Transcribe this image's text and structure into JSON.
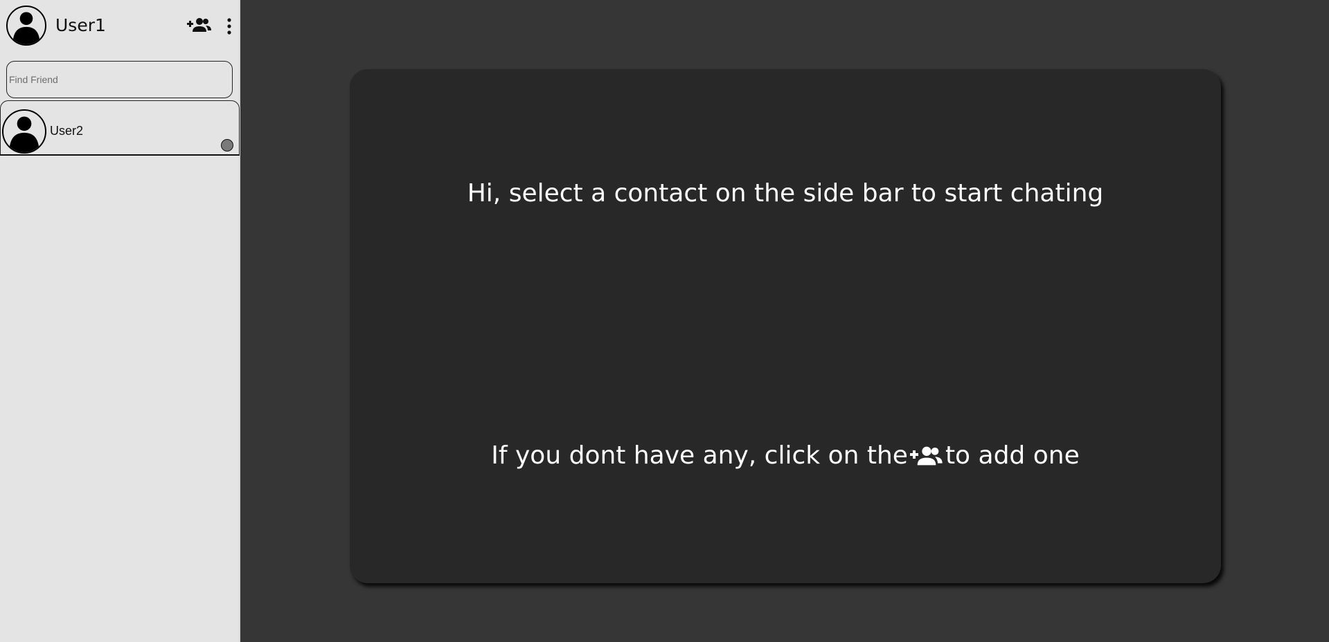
{
  "user": {
    "name": "User1"
  },
  "header": {
    "add_friend_icon": "person-add-icon",
    "menu_icon": "more-vertical-icon"
  },
  "search": {
    "placeholder": "Find Friend"
  },
  "contacts": [
    {
      "name": "User2",
      "status_color": "#7a7a7a"
    }
  ],
  "main": {
    "greeting": "Hi, select a contact on the side bar to start chating",
    "hint_before": "If you dont have any, click on the",
    "hint_icon": "person-add-icon",
    "hint_after": "to add one"
  },
  "colors": {
    "background": "#363636",
    "sidebar": "#e4e4e4",
    "card": "#282828",
    "text_light": "#ffffff"
  }
}
